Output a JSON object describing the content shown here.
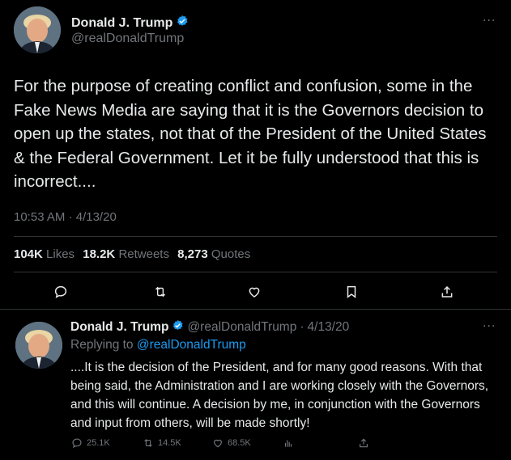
{
  "tweet": {
    "display_name": "Donald J. Trump",
    "handle": "@realDonaldTrump",
    "text": "For the purpose of creating conflict and confusion, some in the Fake News Media are saying that it is the Governors decision to open up the states, not that of the President of the United States & the Federal Government. Let it be fully understood that this is incorrect....",
    "time": "10:53 AM",
    "separator": "·",
    "date": "4/13/20",
    "stats": {
      "likes_value": "104K",
      "likes_label": "Likes",
      "retweets_value": "18.2K",
      "retweets_label": "Retweets",
      "quotes_value": "8,273",
      "quotes_label": "Quotes"
    },
    "more_icon": "ellipsis-icon"
  },
  "reply": {
    "display_name": "Donald J. Trump",
    "handle": "@realDonaldTrump",
    "separator": "·",
    "date": "4/13/20",
    "replying_prefix": "Replying to",
    "replying_to": "@realDonaldTrump",
    "text": "....It is the decision of the President, and for many good reasons. With that being said, the Administration and I are working closely with the Governors, and this will continue. A decision by me, in conjunction with the Governors and input from others, will be made shortly!",
    "replies_count": "25.1K",
    "retweets_count": "14.5K",
    "likes_count": "68.5K"
  },
  "colors": {
    "background": "#000000",
    "text": "#e7e9ea",
    "muted": "#71767b",
    "accent": "#1d9bf0",
    "divider": "#2f3336"
  }
}
